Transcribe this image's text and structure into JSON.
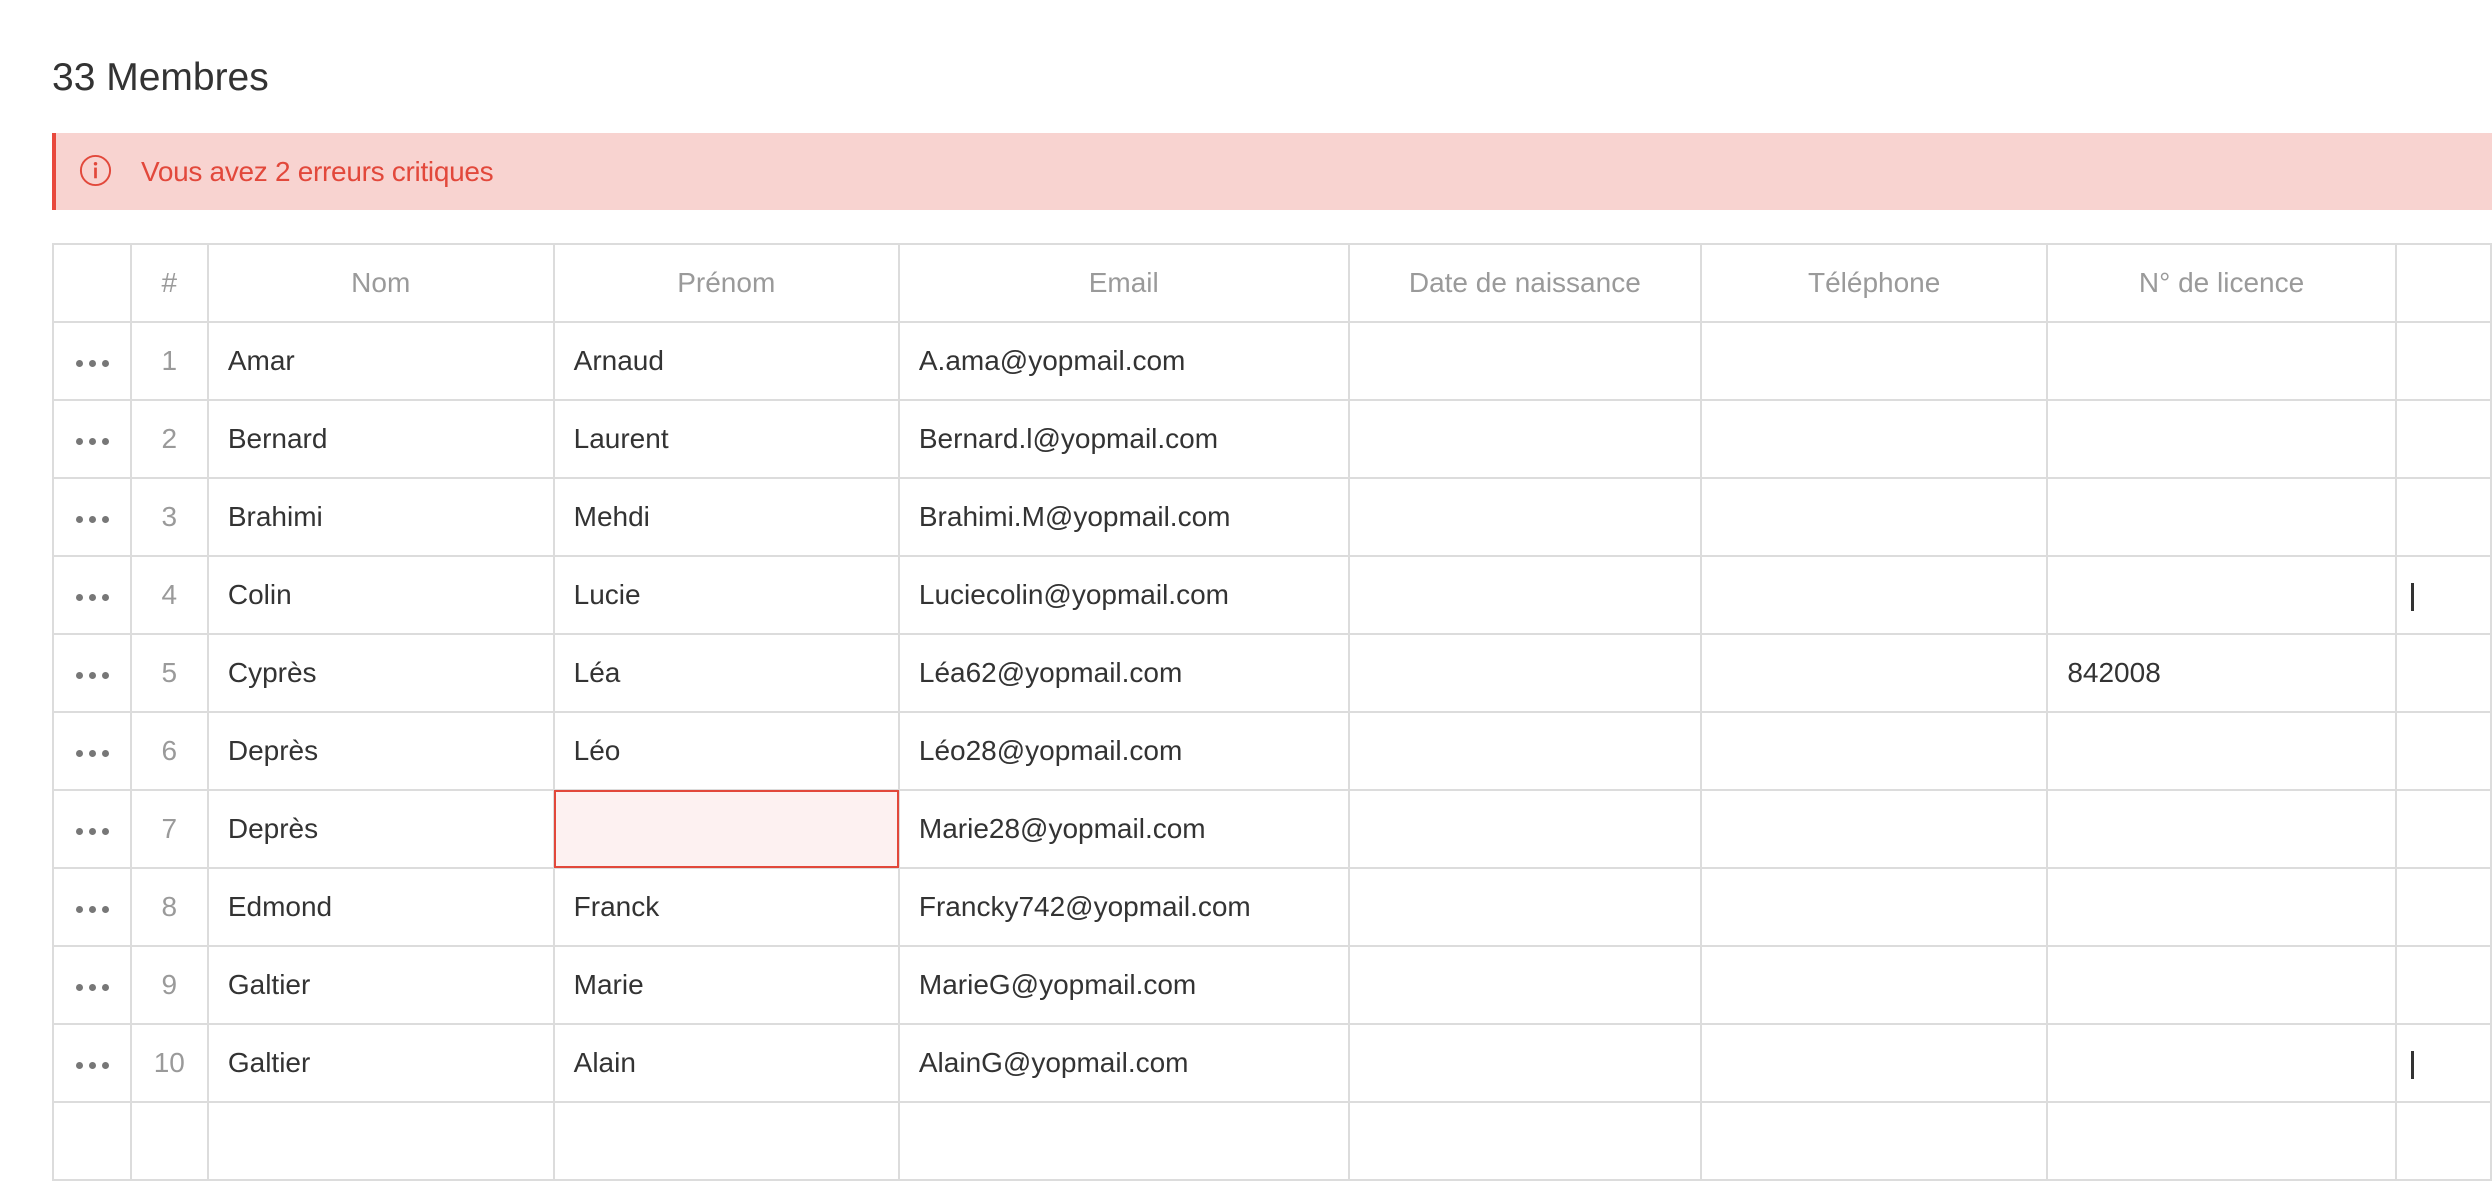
{
  "page": {
    "title": "33 Membres"
  },
  "alert": {
    "icon": "info-circle-icon",
    "message": "Vous avez 2 erreurs critiques",
    "color": "#e2483b",
    "background": "#f8d3d0"
  },
  "table": {
    "columns": [
      "",
      "#",
      "Nom",
      "Prénom",
      "Email",
      "Date de naissance",
      "Téléphone",
      "N° de licence",
      ""
    ],
    "rows": [
      {
        "num": "1",
        "nom": "Amar",
        "prenom": "Arnaud",
        "email": "A.ama@yopmail.com",
        "naissance": "",
        "telephone": "",
        "licence": "",
        "error_prenom": false,
        "partial_next": false
      },
      {
        "num": "2",
        "nom": "Bernard",
        "prenom": "Laurent",
        "email": "Bernard.l@yopmail.com",
        "naissance": "",
        "telephone": "",
        "licence": "",
        "error_prenom": false,
        "partial_next": false
      },
      {
        "num": "3",
        "nom": "Brahimi",
        "prenom": "Mehdi",
        "email": "Brahimi.M@yopmail.com",
        "naissance": "",
        "telephone": "",
        "licence": "",
        "error_prenom": false,
        "partial_next": false
      },
      {
        "num": "4",
        "nom": "Colin",
        "prenom": "Lucie",
        "email": "Luciecolin@yopmail.com",
        "naissance": "",
        "telephone": "",
        "licence": "",
        "error_prenom": false,
        "partial_next": true
      },
      {
        "num": "5",
        "nom": "Cyprès",
        "prenom": "Léa",
        "email": "Léa62@yopmail.com",
        "naissance": "",
        "telephone": "",
        "licence": "842008",
        "error_prenom": false,
        "partial_next": false
      },
      {
        "num": "6",
        "nom": "Deprès",
        "prenom": "Léo",
        "email": "Léo28@yopmail.com",
        "naissance": "",
        "telephone": "",
        "licence": "",
        "error_prenom": false,
        "partial_next": false
      },
      {
        "num": "7",
        "nom": "Deprès",
        "prenom": "",
        "email": "Marie28@yopmail.com",
        "naissance": "",
        "telephone": "",
        "licence": "",
        "error_prenom": true,
        "partial_next": false
      },
      {
        "num": "8",
        "nom": "Edmond",
        "prenom": "Franck",
        "email": "Francky742@yopmail.com",
        "naissance": "",
        "telephone": "",
        "licence": "",
        "error_prenom": false,
        "partial_next": false
      },
      {
        "num": "9",
        "nom": "Galtier",
        "prenom": "Marie",
        "email": "MarieG@yopmail.com",
        "naissance": "",
        "telephone": "",
        "licence": "",
        "error_prenom": false,
        "partial_next": false
      },
      {
        "num": "10",
        "nom": "Galtier",
        "prenom": "Alain",
        "email": "AlainG@yopmail.com",
        "naissance": "",
        "telephone": "",
        "licence": "",
        "error_prenom": false,
        "partial_next": true
      },
      {
        "num": "",
        "nom": "",
        "prenom": "",
        "email": "",
        "naissance": "",
        "telephone": "",
        "licence": "",
        "error_prenom": false,
        "partial_next": false
      }
    ]
  },
  "icons": {
    "row_menu": "more-horizontal-icon"
  }
}
